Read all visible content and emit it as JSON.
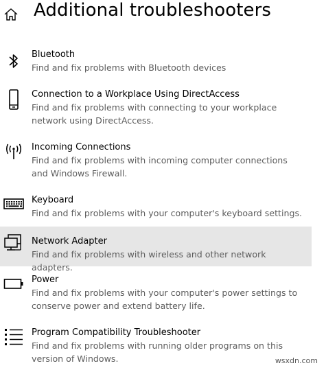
{
  "header": {
    "title": "Additional troubleshooters",
    "home_icon": "home-icon"
  },
  "items": [
    {
      "icon": "bluetooth-icon",
      "title": "Bluetooth",
      "description": "Find and fix problems with Bluetooth devices",
      "selected": false
    },
    {
      "icon": "phone-icon",
      "title": "Connection to a Workplace Using DirectAccess",
      "description": "Find and fix problems with connecting to your workplace network using DirectAccess.",
      "selected": false
    },
    {
      "icon": "antenna-icon",
      "title": "Incoming Connections",
      "description": "Find and fix problems with incoming computer connections and Windows Firewall.",
      "selected": false
    },
    {
      "icon": "keyboard-icon",
      "title": "Keyboard",
      "description": "Find and fix problems with your computer's keyboard settings.",
      "selected": false
    },
    {
      "icon": "network-adapter-icon",
      "title": "Network Adapter",
      "description": "Find and fix problems with wireless and other network adapters.",
      "selected": true
    },
    {
      "icon": "battery-icon",
      "title": "Power",
      "description": "Find and fix problems with your computer's power settings to conserve power and extend battery life.",
      "selected": false
    },
    {
      "icon": "list-icon",
      "title": "Program Compatibility Troubleshooter",
      "description": "Find and fix problems with running older programs on this version of Windows.",
      "selected": false
    }
  ],
  "watermark": "wsxdn.com",
  "colors": {
    "selected_background": "#e6e6e6",
    "description_text": "#5c5c5c"
  }
}
